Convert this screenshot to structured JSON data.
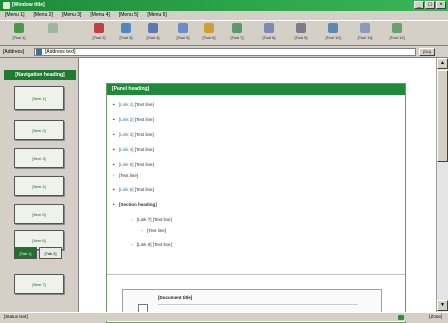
{
  "window": {
    "title": "[Window title]",
    "buttons": [
      "_",
      "□",
      "×"
    ]
  },
  "menu": [
    "[Menu 1]",
    "[Menu 2]",
    "[Menu 3]",
    "[Menu 4]",
    "[Menu 5]",
    "[Menu 6]"
  ],
  "toolbar": [
    {
      "label": "[Tool 1]",
      "icon": "back-arrow-icon"
    },
    {
      "label": "",
      "icon": "forward-arrow-icon"
    },
    {
      "label": "[Tool 2]",
      "icon": "stop-icon"
    },
    {
      "label": "[Tool 3]",
      "icon": "refresh-icon"
    },
    {
      "label": "[Tool 4]",
      "icon": "home-icon"
    },
    {
      "label": "[Tool 5]",
      "icon": "search-icon"
    },
    {
      "label": "[Tool 6]",
      "icon": "favorites-icon"
    },
    {
      "label": "[Tool 7]",
      "icon": "history-icon"
    },
    {
      "label": "[Tool 8]",
      "icon": "mail-icon"
    },
    {
      "label": "[Tool 9]",
      "icon": "print-icon"
    },
    {
      "label": "[Tool 10]",
      "icon": "edit-icon"
    },
    {
      "label": "[Tool 11]",
      "icon": "discuss-icon"
    },
    {
      "label": "[Tool 12]",
      "icon": "messenger-icon"
    }
  ],
  "address": {
    "label": "[Address]",
    "value": "[Address text]",
    "go": "[Go]"
  },
  "nav": {
    "heading": "[Navigation heading]",
    "items": [
      "[Item 1]",
      "[Item 2]",
      "[Item 3]",
      "[Item 4]",
      "[Item 5]",
      "[Item 6]"
    ],
    "tabs": [
      "[Tab 1]",
      "[Tab 2]"
    ],
    "bottom": "[Item 7]"
  },
  "panel": {
    "heading": "[Panel heading]",
    "bullets": [
      {
        "link": "[Link 1]",
        "text": "[Text line]"
      },
      {
        "link": "[Link 2]",
        "text": "[Text line]"
      },
      {
        "link": "[Link 3]",
        "text": "[Text line]"
      },
      {
        "link": "[Link 4]",
        "text": "[Text line]"
      },
      {
        "link": "[Link 5]",
        "text": "[Text line]"
      },
      {
        "link": "",
        "text": "[Text line]"
      },
      {
        "link": "[Link 6]",
        "text": "[Text line]"
      }
    ],
    "section": "[Section heading]",
    "subs": [
      {
        "link": "[Link 7]",
        "text": "[Text line]"
      },
      {
        "link": "",
        "text": "[Text line]"
      },
      {
        "link": "[Link 8]",
        "text": "[Text line]"
      }
    ],
    "doc_title": "[Document title]"
  },
  "status": {
    "text": "[Status text]",
    "zone": "[Zone]"
  },
  "colors": {
    "title_green": "#1e8a3a",
    "nav_green": "#1f7a34",
    "link_blue": "#2f6f9f"
  }
}
